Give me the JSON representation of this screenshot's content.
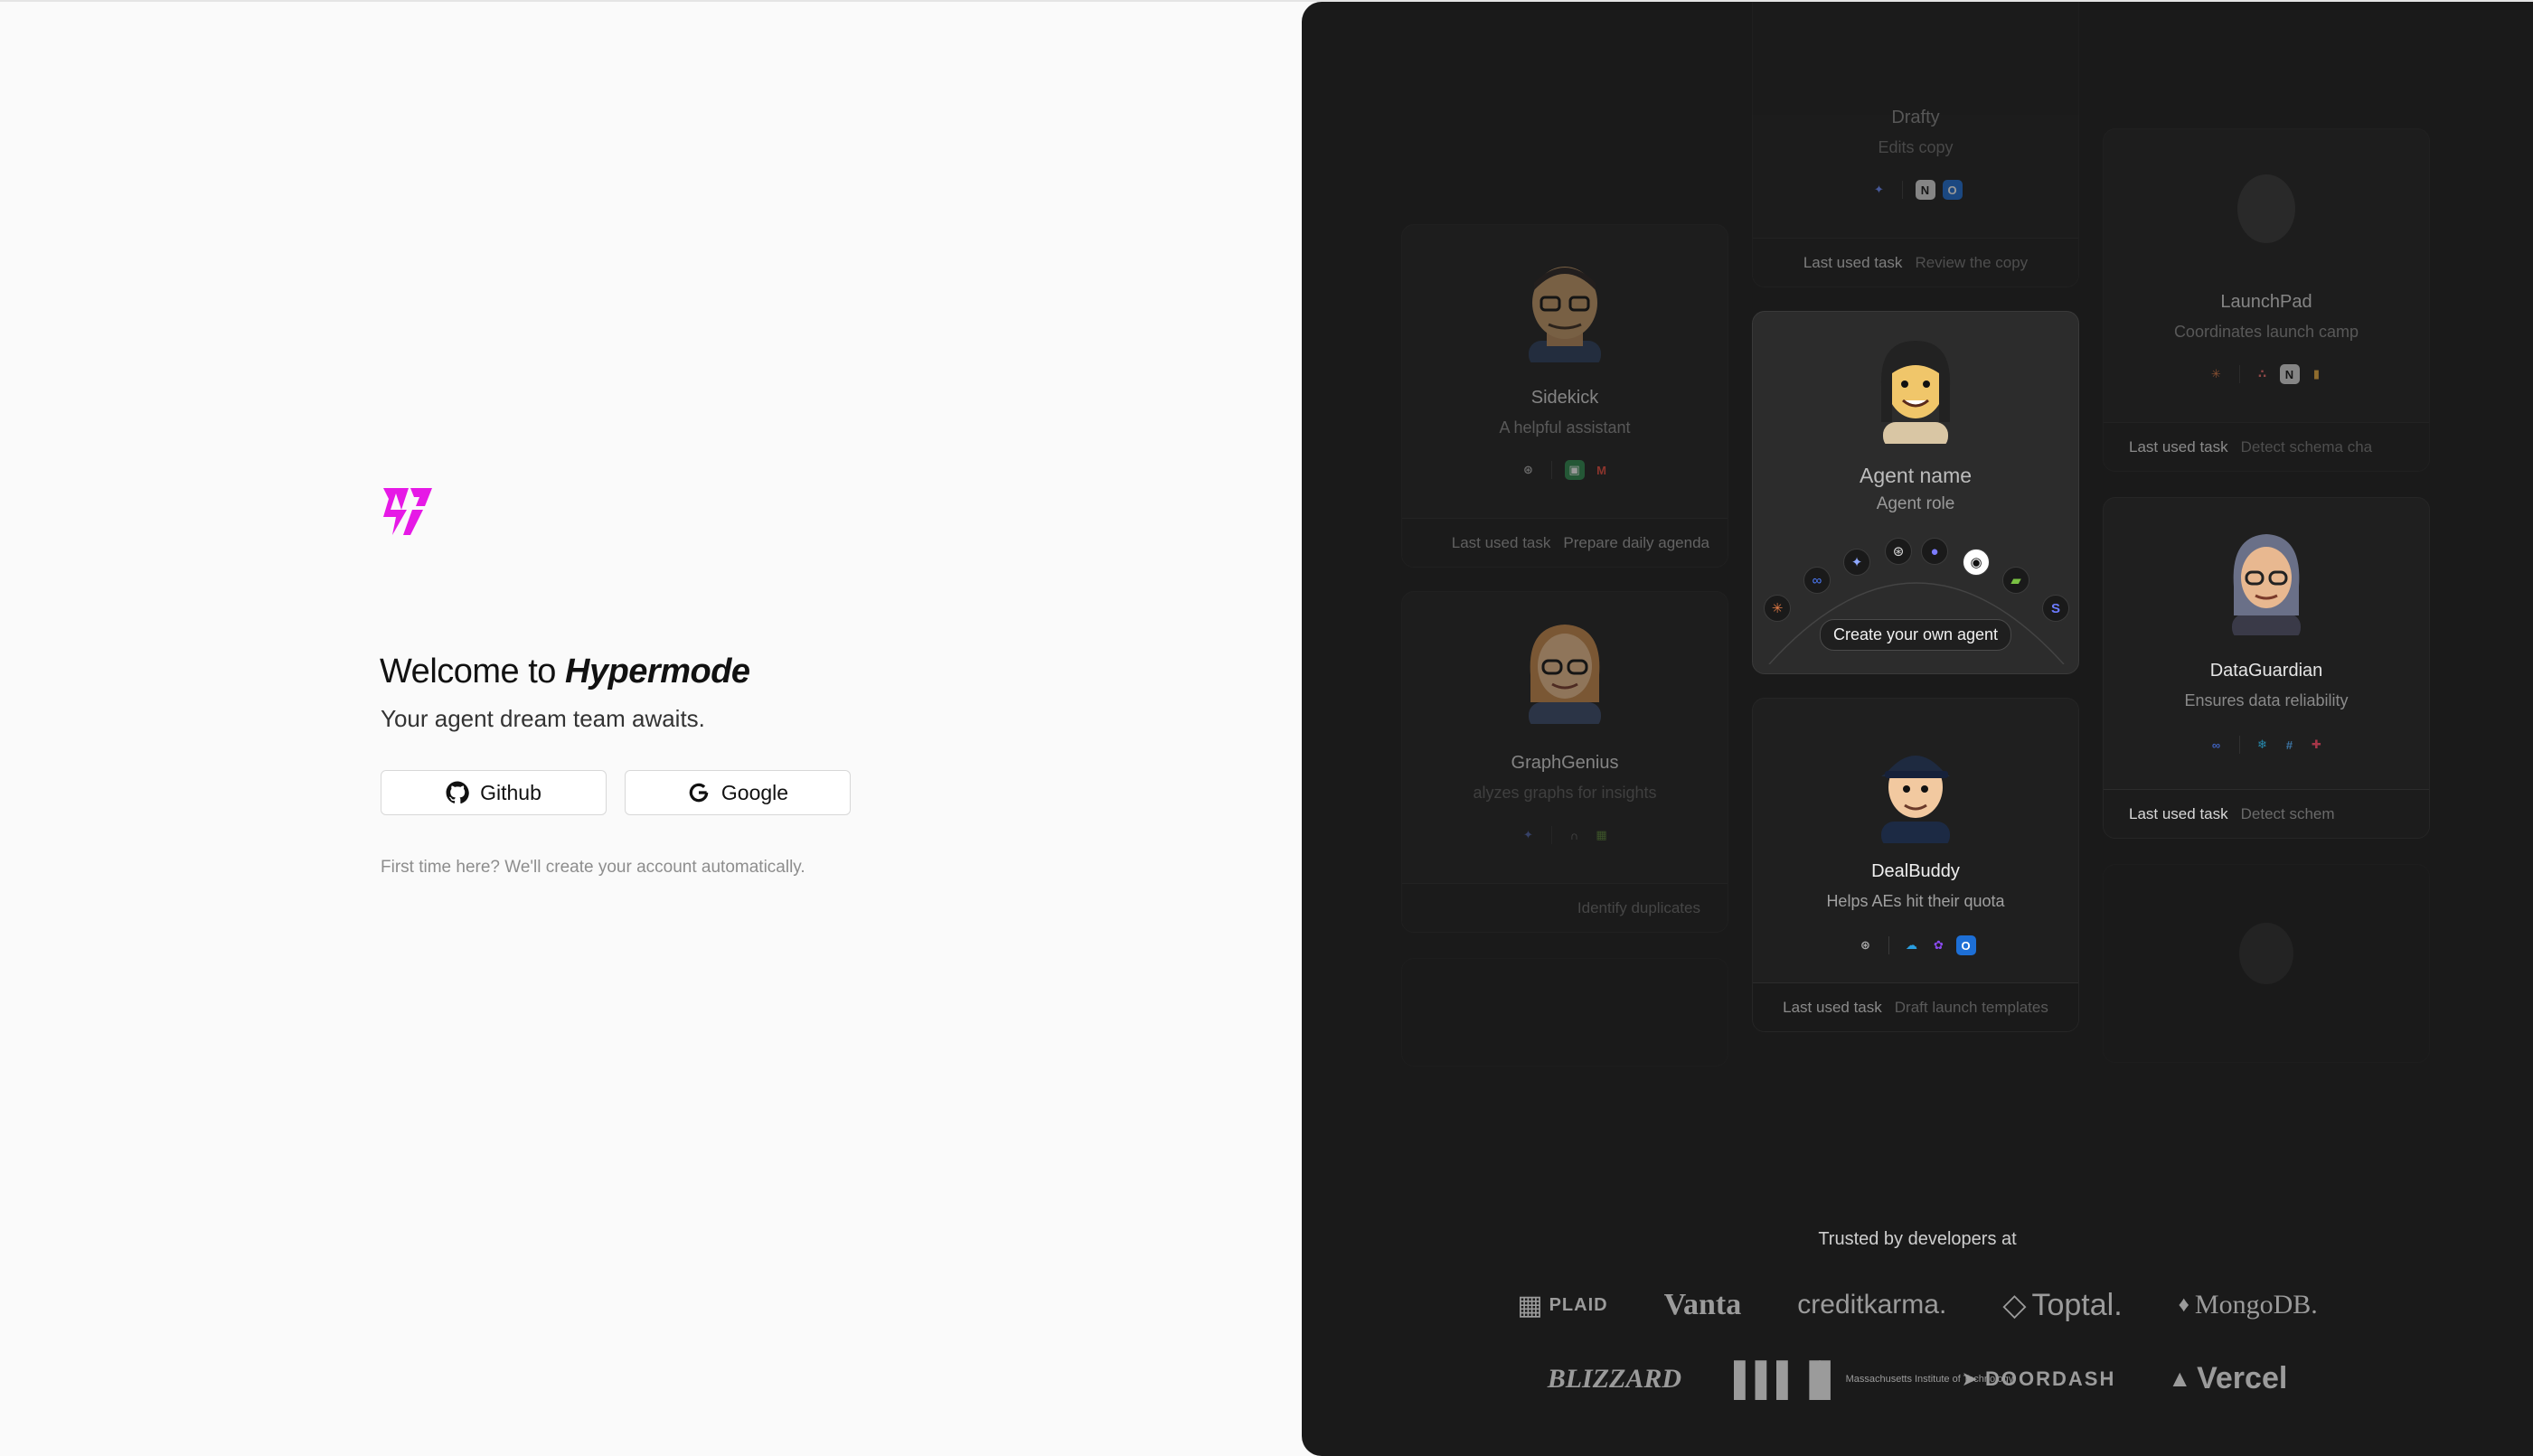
{
  "welcome": {
    "title_prefix": "Welcome to",
    "brand": "Hypermode",
    "subtitle": "Your agent dream team awaits.",
    "github_label": "Github",
    "google_label": "Google",
    "note": "First time here? We'll create your account automatically."
  },
  "colors": {
    "brand": "#e619e6",
    "panel": "#1a1a1a"
  },
  "agents": {
    "drafty": {
      "name": "Drafty",
      "role": "Edits copy",
      "task_label": "Last used task",
      "task": "Review the copy",
      "icons": [
        "sparkle-icon",
        "notion-icon",
        "outlook-icon"
      ]
    },
    "sidekick": {
      "name": "Sidekick",
      "role": "A helpful assistant",
      "task_label": "Last used task",
      "task": "Prepare daily agenda",
      "icons": [
        "openai-icon",
        "google-meet-icon",
        "gmail-icon"
      ]
    },
    "launchpad": {
      "name": "LaunchPad",
      "role": "Coordinates launch camp",
      "task_label": "Last used task",
      "task": "Detect schema cha",
      "icons": [
        "claude-icon",
        "asana-icon",
        "notion-icon",
        "chart-icon"
      ]
    },
    "create": {
      "name": "Agent name",
      "role": "Agent role",
      "cta": "Create your own agent"
    },
    "graphgenius": {
      "name": "GraphGenius",
      "role": "alyzes graphs for insights",
      "task": "Identify duplicates"
    },
    "dataguardian": {
      "name": "DataGuardian",
      "role": "Ensures data reliability",
      "task_label": "Last used task",
      "task": "Detect schem"
    },
    "dealbuddy": {
      "name": "DealBuddy",
      "role": "Helps AEs hit their quota",
      "task_label": "Last used task",
      "task": "Draft launch templates"
    }
  },
  "trusted": {
    "heading": "Trusted by developers at",
    "row1": [
      "PLAID",
      "Vanta",
      "creditkarma.",
      "Toptal.",
      "MongoDB."
    ],
    "row2": [
      "BLIZZARD",
      "Massachusetts Institute of Technology",
      "DOORDASH",
      "Vercel"
    ]
  }
}
